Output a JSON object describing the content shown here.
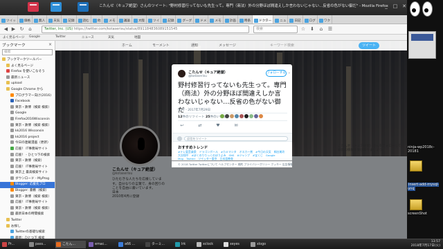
{
  "window": {
    "title": "こたんせ（キュア絶望）さんのツイート: \"野村修習行ってないも先生って。専門（商法）外の分野ほぼ間違えしか言わないじゃない…反省の色がない御だ\" - Mozilla Firefox",
    "controls": [
      "_",
      "□",
      "✕"
    ]
  },
  "tabs": [
    {
      "label": "ツイッ"
    },
    {
      "label": "価格"
    },
    {
      "label": "無人"
    },
    {
      "label": "天気"
    },
    {
      "label": "記録"
    },
    {
      "label": "読む"
    },
    {
      "label": "他"
    },
    {
      "label": "メモ"
    },
    {
      "label": "議論"
    },
    {
      "label": "大阪"
    },
    {
      "label": "ツイ"
    },
    {
      "label": "記録"
    },
    {
      "label": "グーグ"
    },
    {
      "label": "ドメ"
    },
    {
      "label": "メモ"
    },
    {
      "label": "計画"
    },
    {
      "label": "時系"
    },
    {
      "label": "ドクター"
    },
    {
      "label": "ニュ"
    },
    {
      "label": "日記"
    },
    {
      "label": "ログ"
    },
    {
      "label": "ワク"
    }
  ],
  "nav": {
    "back": "◀",
    "forward": "▶",
    "reload": "↻",
    "home": "⌂",
    "url_site": "Twitter, Inc. (US)",
    "url_path": "https://twitter.com/kotaserisu/status/891184836089151545",
    "search_placeholder": "検索"
  },
  "toolbar_icons": [
    "☆",
    "⬇",
    "⌂",
    "☰"
  ],
  "bookmarks_bar": [
    "よく見るページ",
    "Google",
    "Twitter",
    "ニュース",
    "天気",
    "地図"
  ],
  "sidebar": {
    "title": "ブックマーク",
    "close": "×",
    "search_placeholder": "検索",
    "items": [
      {
        "label": "ブックマークツールバー",
        "icon": "folder",
        "indent": 0
      },
      {
        "label": "よく見るページ",
        "icon": "folder",
        "indent": 1
      },
      {
        "label": "Firefox を使いこなそう",
        "icon": "red",
        "indent": 1
      },
      {
        "label": "最新ニュース",
        "icon": "grey",
        "indent": 1
      },
      {
        "label": "upload",
        "icon": "folder",
        "indent": 1
      },
      {
        "label": "Google Chrome から",
        "icon": "folder",
        "indent": 1
      },
      {
        "label": "プログラマー向け(2016)",
        "icon": "orange",
        "indent": 2
      },
      {
        "label": "Facebook",
        "icon": "blue",
        "indent": 2
      },
      {
        "label": "東京・鉄博（検索 検索）",
        "icon": "grey",
        "indent": 2
      },
      {
        "label": "Google",
        "icon": "grey",
        "indent": 2
      },
      {
        "label": "Firefox2016Wisconsin",
        "icon": "grey",
        "indent": 2
      },
      {
        "label": "東京・鉄博（検索 検索）",
        "icon": "grey",
        "indent": 2
      },
      {
        "label": "kk2016 Wisconsin",
        "icon": "grey",
        "indent": 2
      },
      {
        "label": "kk2016 project",
        "icon": "grey",
        "indent": 2
      },
      {
        "label": "今日の連載漫画（更新）",
        "icon": "grey",
        "indent": 2
      },
      {
        "label": "応援！ IT事務局サイト",
        "icon": "green",
        "indent": 2
      },
      {
        "label": "応援！ - ひとつ下の検索",
        "icon": "grey",
        "indent": 2
      },
      {
        "label": "東京・鉄博（検索）",
        "icon": "grey",
        "indent": 2
      },
      {
        "label": "応援！ IT事務局サイト",
        "icon": "grey",
        "indent": 2
      },
      {
        "label": "東京上 最高検索サイト",
        "icon": "grey",
        "indent": 2
      },
      {
        "label": "ダウンロード - MyProg",
        "icon": "grey",
        "indent": 2
      },
      {
        "label": "Blogger: 応援先ブロ",
        "icon": "orange",
        "indent": 2,
        "selected": true
      },
      {
        "label": "Blogger: 書棚（検索）",
        "icon": "orange",
        "indent": 2
      },
      {
        "label": "東京・鉄博（検索 検索）",
        "icon": "grey",
        "indent": 2
      },
      {
        "label": "応援！ IT事務局サイト",
        "icon": "grey",
        "indent": 2
      },
      {
        "label": "東京・鉄博（検索 検索）",
        "icon": "grey",
        "indent": 2
      },
      {
        "label": "最新日本の時間検索",
        "icon": "grey",
        "indent": 2
      },
      {
        "label": "Twitter",
        "icon": "folder",
        "indent": 1
      },
      {
        "label": "お探し",
        "icon": "folder",
        "indent": 1
      },
      {
        "label": "Twitterの基礎な検索",
        "icon": "tw",
        "indent": 2
      },
      {
        "label": "最新：ひとつ下 検索",
        "icon": "tw",
        "indent": 2
      },
      {
        "label": "最新：ひとつ下 検索",
        "icon": "tw",
        "indent": 2
      },
      {
        "label": "グループ",
        "icon": "folder",
        "indent": 1
      },
      {
        "label": "実業家をsSyfrAuto",
        "icon": "tw",
        "indent": 2
      }
    ]
  },
  "twitter_nav": {
    "home": "ホーム",
    "moments": "モーメント",
    "notifications": "通知",
    "messages": "メッセージ",
    "search_placeholder": "キーワード検索",
    "tweet_button": "ツイート"
  },
  "profile": {
    "name": "こたんせ（キュア絶望）",
    "handle": "@kotaserisu",
    "bio": "ひたむきな人たちを応援しています。自分なりの言葉で、身の回りのことを自由に書いています。",
    "location": "日本",
    "joined": "2010年4月に登録"
  },
  "tweet": {
    "author": "こたんせ（キュア絶望）",
    "handle": "@kotaserisu",
    "follow_label": "フォローする",
    "text": "野村修習行ってないも先生って。専門（商法）外の分野ほぼ間違えしか言わないじゃない…反省の色がない御だ",
    "time": "9:27 - 2017年7月29日",
    "retweets": "12",
    "retweets_label": "件のリツイート",
    "likes": "25",
    "likes_label": "件のいいね",
    "reply_placeholder": "返信をツイート",
    "actions": {
      "reply": "↩",
      "retweet": "⇄",
      "like": "♥",
      "dm": "✉"
    }
  },
  "trends": {
    "title": "おすすめトレンド",
    "items": [
      "#テレ東音楽祭",
      "ドラゴンボール",
      "#カミマシタ",
      "オスカー賞",
      "#今日の天気",
      "桐谷美玲",
      "大谷翔平",
      "#ぼくのりりっくのぼうよみ",
      "SNS",
      "#ジャンプ",
      "#宝くじ",
      "Google Map",
      "Twitter",
      "ツイッター東京",
      "日本語教育"
    ]
  },
  "footer": "© 2018 Twitter  Twitterについて  ヘルプセンター  規約  プライバシーポリシー  クッキー  広告情報",
  "right_col": "こたんせ（キュア絶望）さんをフォローして、最新の情報を受け取りましょう。",
  "desktop": {
    "labels": [
      "ninja-wp2018c-20181",
      "insert-add-mysql-unq",
      "screenShot"
    ]
  },
  "taskbar": {
    "tasks": [
      {
        "label": "Pr...",
        "color": "#c44"
      },
      {
        "label": "pass...",
        "color": "#888"
      },
      {
        "label": "こたん...",
        "color": "#e76b1f",
        "active": true
      },
      {
        "label": "emac...",
        "color": "#7a5fb0"
      },
      {
        "label": "a66 ...",
        "color": "#3d7dd8"
      },
      {
        "label": "ターミ...",
        "color": "#444"
      },
      {
        "label": "Irk",
        "color": "#29a"
      },
      {
        "label": "xclock",
        "color": "#bbb"
      },
      {
        "label": "xeyes",
        "color": "#ddd"
      },
      {
        "label": "xlogo",
        "color": "#999"
      }
    ],
    "clock_time": "13:57",
    "clock_date": "2018年7月17日(火)"
  },
  "colors": {
    "twitter_blue": "#1da1f2",
    "selection": "#3875d7",
    "panel": "#262626"
  }
}
